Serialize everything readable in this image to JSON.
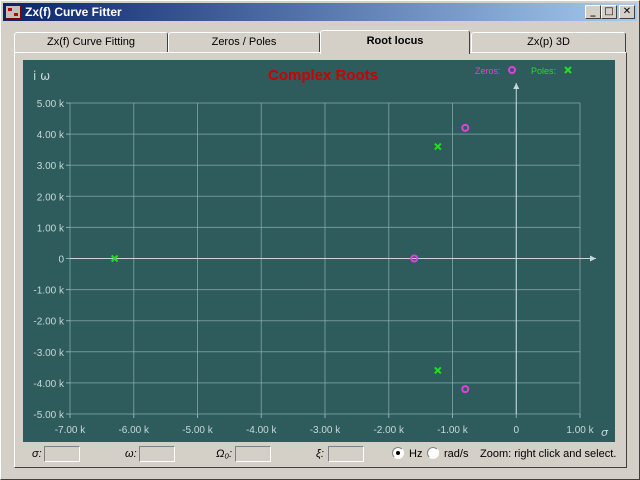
{
  "window": {
    "title": "Zx(f) Curve Fitter",
    "minimize": "_",
    "maximize": "□",
    "close": "✕"
  },
  "tabs": [
    {
      "label": "Zx(f) Curve Fitting",
      "active": false
    },
    {
      "label": "Zeros / Poles",
      "active": false
    },
    {
      "label": "Root locus",
      "active": true
    },
    {
      "label": "Zx(p) 3D",
      "active": false
    }
  ],
  "chart_data": {
    "type": "scatter",
    "title": "Complex Roots",
    "ylabel": "i ω",
    "xlabel": "σ",
    "xlim": [
      -7000,
      1000
    ],
    "ylim": [
      -5000,
      5000
    ],
    "x_ticks": [
      -7000,
      -6000,
      -5000,
      -4000,
      -3000,
      -2000,
      -1000,
      0,
      1000
    ],
    "x_tick_labels": [
      "-7.00 k",
      "-6.00 k",
      "-5.00 k",
      "-4.00 k",
      "-3.00 k",
      "-2.00 k",
      "-1.00 k",
      "0",
      "1.00 k"
    ],
    "y_ticks": [
      5000,
      4000,
      3000,
      2000,
      1000,
      0,
      -1000,
      -2000,
      -3000,
      -4000,
      -5000
    ],
    "y_tick_labels": [
      "5.00 k",
      "4.00 k",
      "3.00 k",
      "2.00 k",
      "1.00 k",
      "0",
      "-1.00 k",
      "-2.00 k",
      "-3.00 k",
      "-4.00 k",
      "-5.00 k"
    ],
    "grid": true,
    "legend_position": "top-right",
    "series": [
      {
        "name": "Zeros:",
        "marker": "circle",
        "color": "#e040e0",
        "points": [
          [
            -800,
            4200
          ],
          [
            -1600,
            0
          ],
          [
            -800,
            -4200
          ]
        ]
      },
      {
        "name": "Poles:",
        "marker": "x",
        "color": "#20e020",
        "points": [
          [
            -1230,
            3600
          ],
          [
            -6300,
            0
          ],
          [
            -1230,
            -3600
          ]
        ]
      }
    ],
    "title_color": "#cc0000",
    "background": "#2e5c5c",
    "grid_color": "#8fb0b0",
    "text_color": "#c8d8d8"
  },
  "bottom": {
    "sigma_label": "σ:",
    "omega_label": "ω:",
    "omega0_label": "Ω₀:",
    "xi_label": "ξ:",
    "sigma_value": "",
    "omega_value": "",
    "omega0_value": "",
    "xi_value": "",
    "unit_hz": "Hz",
    "unit_rads": "rad/s",
    "unit_selected": "Hz",
    "hint": "Zoom: right click and select."
  }
}
